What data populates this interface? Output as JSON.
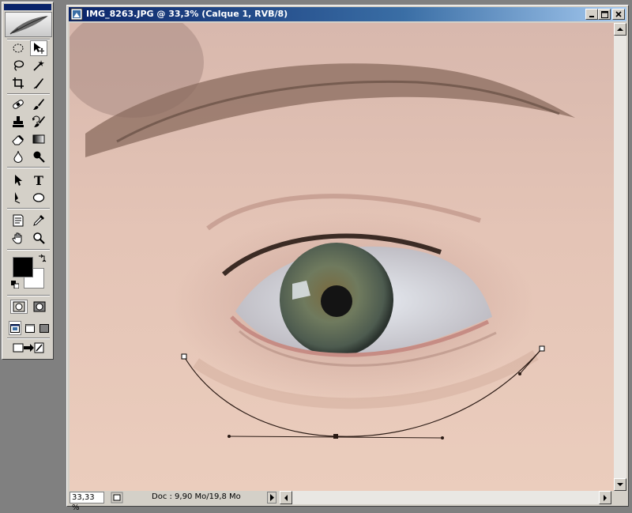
{
  "toolbox": {
    "tools": [
      {
        "name": "marquee-tool",
        "icon": "ellipse-marquee-icon"
      },
      {
        "name": "move-tool",
        "icon": "move-icon"
      },
      {
        "name": "lasso-tool",
        "icon": "lasso-icon"
      },
      {
        "name": "magic-wand-tool",
        "icon": "magic-wand-icon"
      },
      {
        "name": "crop-tool",
        "icon": "crop-icon"
      },
      {
        "name": "slice-tool",
        "icon": "slice-icon"
      },
      {
        "name": "healing-tool",
        "icon": "bandage-icon"
      },
      {
        "name": "brush-tool",
        "icon": "brush-icon"
      },
      {
        "name": "stamp-tool",
        "icon": "stamp-icon"
      },
      {
        "name": "history-brush-tool",
        "icon": "history-brush-icon"
      },
      {
        "name": "eraser-tool",
        "icon": "eraser-icon"
      },
      {
        "name": "gradient-tool",
        "icon": "gradient-icon"
      },
      {
        "name": "blur-tool",
        "icon": "drop-icon"
      },
      {
        "name": "dodge-tool",
        "icon": "dodge-icon"
      },
      {
        "name": "path-selection-tool",
        "icon": "arrow-icon"
      },
      {
        "name": "type-tool",
        "icon": "type-icon"
      },
      {
        "name": "pen-tool",
        "icon": "pen-icon"
      },
      {
        "name": "shape-tool",
        "icon": "ellipse-shape-icon"
      },
      {
        "name": "notes-tool",
        "icon": "note-icon"
      },
      {
        "name": "eyedropper-tool",
        "icon": "eyedropper-icon"
      },
      {
        "name": "hand-tool",
        "icon": "hand-icon"
      },
      {
        "name": "zoom-tool",
        "icon": "magnifier-icon"
      }
    ],
    "type_glyph": "T",
    "foreground_color": "#000000",
    "background_color": "#ffffff"
  },
  "document": {
    "title": "IMG_8263.JPG @ 33,3% (Calque 1, RVB/8)",
    "zoom": "33,33 %",
    "doc_info": "Doc : 9,90 Mo/19,8 Mo"
  },
  "colors": {
    "titlebar_start": "#0a246a",
    "titlebar_end": "#a6caf0",
    "chrome": "#d4d0c8",
    "workspace": "#808080"
  }
}
